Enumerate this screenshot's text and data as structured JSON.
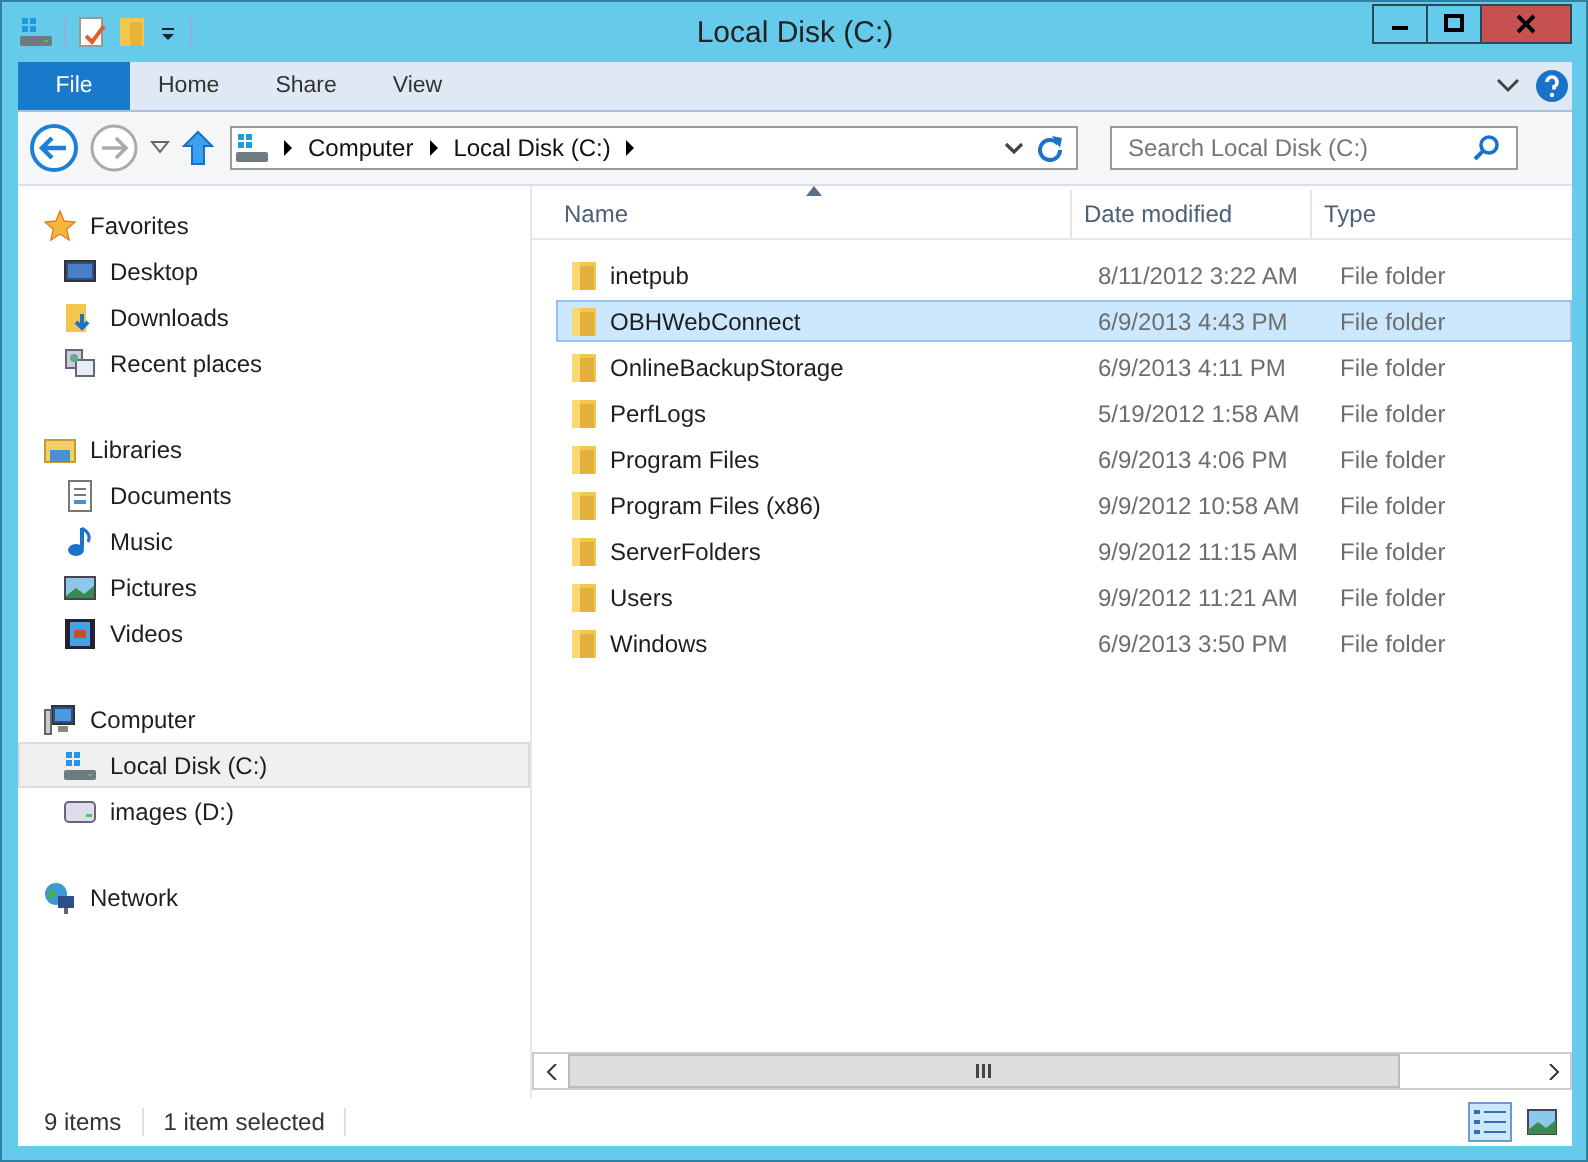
{
  "window": {
    "title": "Local Disk (C:)"
  },
  "ribbon": {
    "tabs": [
      {
        "label": "File",
        "kind": "file"
      },
      {
        "label": "Home",
        "kind": "tab"
      },
      {
        "label": "Share",
        "kind": "tab"
      },
      {
        "label": "View",
        "kind": "tab"
      }
    ]
  },
  "address": {
    "crumbs": [
      "Computer",
      "Local Disk (C:)"
    ]
  },
  "search": {
    "placeholder": "Search Local Disk (C:)"
  },
  "sidebar": {
    "groups": [
      {
        "label": "Favorites",
        "kind": "star",
        "items": [
          {
            "label": "Desktop",
            "kind": "desktop",
            "selected": false
          },
          {
            "label": "Downloads",
            "kind": "downloads",
            "selected": false
          },
          {
            "label": "Recent places",
            "kind": "recent",
            "selected": false
          }
        ]
      },
      {
        "label": "Libraries",
        "kind": "library",
        "items": [
          {
            "label": "Documents",
            "kind": "document",
            "selected": false
          },
          {
            "label": "Music",
            "kind": "music",
            "selected": false
          },
          {
            "label": "Pictures",
            "kind": "pictures",
            "selected": false
          },
          {
            "label": "Videos",
            "kind": "videos",
            "selected": false
          }
        ]
      },
      {
        "label": "Computer",
        "kind": "computer",
        "items": [
          {
            "label": "Local Disk (C:)",
            "kind": "sysdrive",
            "selected": true
          },
          {
            "label": "images (D:)",
            "kind": "drive",
            "selected": false
          }
        ]
      },
      {
        "label": "Network",
        "kind": "network"
      }
    ]
  },
  "table": {
    "columns": [
      "Name",
      "Date modified",
      "Type"
    ],
    "rows": [
      {
        "name": "inetpub",
        "date": "8/11/2012 3:22 AM",
        "type": "File folder",
        "selected": false
      },
      {
        "name": "OBHWebConnect",
        "date": "6/9/2013 4:43 PM",
        "type": "File folder",
        "selected": true
      },
      {
        "name": "OnlineBackupStorage",
        "date": "6/9/2013 4:11 PM",
        "type": "File folder",
        "selected": false
      },
      {
        "name": "PerfLogs",
        "date": "5/19/2012 1:58 AM",
        "type": "File folder",
        "selected": false
      },
      {
        "name": "Program Files",
        "date": "6/9/2013 4:06 PM",
        "type": "File folder",
        "selected": false
      },
      {
        "name": "Program Files (x86)",
        "date": "9/9/2012 10:58 AM",
        "type": "File folder",
        "selected": false
      },
      {
        "name": "ServerFolders",
        "date": "9/9/2012 11:15 AM",
        "type": "File folder",
        "selected": false
      },
      {
        "name": "Users",
        "date": "9/9/2012 11:21 AM",
        "type": "File folder",
        "selected": false
      },
      {
        "name": "Windows",
        "date": "6/9/2013 3:50 PM",
        "type": "File folder",
        "selected": false
      }
    ]
  },
  "status_bar": {
    "count": "9 items",
    "selection": "1 item selected"
  }
}
